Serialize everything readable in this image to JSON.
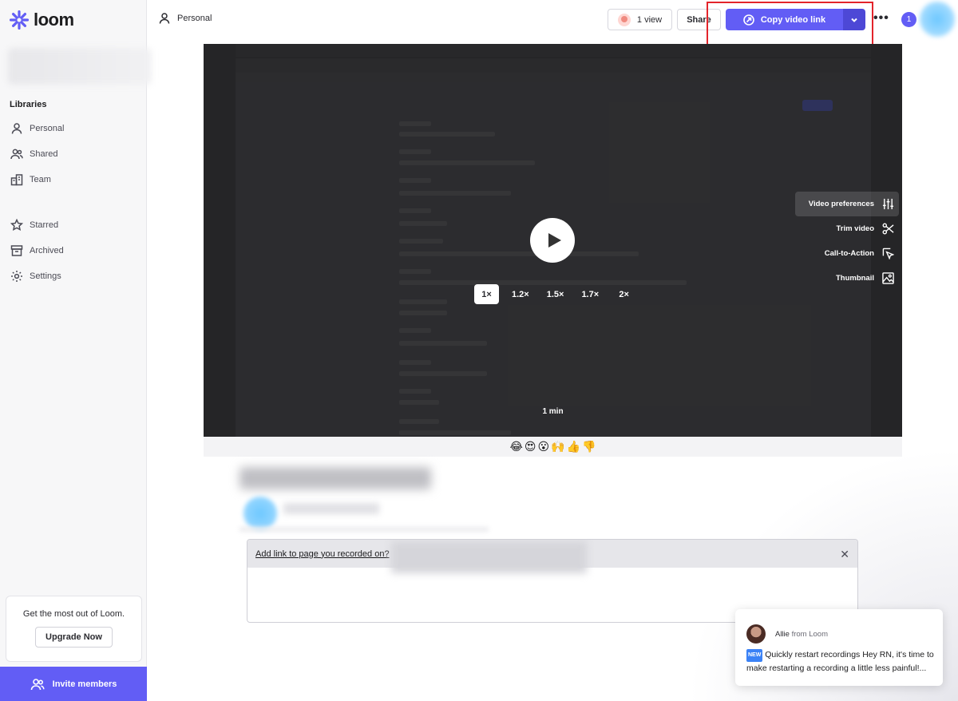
{
  "brand": {
    "name": "loom",
    "accent": "#625df5"
  },
  "sidebar": {
    "section_title": "Libraries",
    "items": [
      {
        "label": "Personal",
        "icon": "person-icon"
      },
      {
        "label": "Shared",
        "icon": "people-icon"
      },
      {
        "label": "Team",
        "icon": "building-icon"
      }
    ],
    "items2": [
      {
        "label": "Starred",
        "icon": "star-icon"
      },
      {
        "label": "Archived",
        "icon": "archive-icon"
      },
      {
        "label": "Settings",
        "icon": "gear-icon"
      }
    ],
    "upsell_text": "Get the most out of Loom.",
    "upgrade_label": "Upgrade Now",
    "invite_label": "Invite members"
  },
  "header": {
    "breadcrumb": "Personal",
    "views_label": "1 view",
    "share_label": "Share",
    "copy_label": "Copy video link",
    "notification_count": "1"
  },
  "video": {
    "speeds": [
      "1×",
      "1.2×",
      "1.5×",
      "1.7×",
      "2×"
    ],
    "active_speed": "1×",
    "duration": "1 min",
    "tools": [
      {
        "label": "Video preferences",
        "icon": "sliders-icon"
      },
      {
        "label": "Trim video",
        "icon": "scissors-icon"
      },
      {
        "label": "Call-to-Action",
        "icon": "cursor-icon"
      },
      {
        "label": "Thumbnail",
        "icon": "image-icon"
      }
    ]
  },
  "reactions": [
    "😂",
    "😍",
    "😮",
    "🙌",
    "👍",
    "👎"
  ],
  "link_prompt": {
    "label": "Add link to page you recorded on?"
  },
  "chat": {
    "author": "Allie",
    "from": "from Loom",
    "badge": "NEW",
    "message": "Quickly restart recordings Hey RN, it's time to make restarting a recording a little less painful!..."
  }
}
